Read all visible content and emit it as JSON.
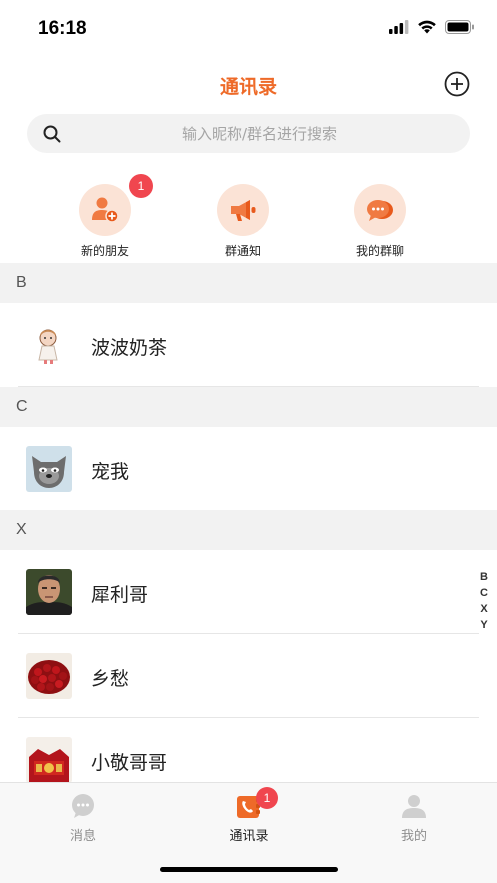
{
  "status_bar": {
    "time": "16:18"
  },
  "nav": {
    "title": "通讯录"
  },
  "search": {
    "placeholder": "输入昵称/群名进行搜索"
  },
  "quick_actions": [
    {
      "label": "新的朋友",
      "badge": "1",
      "icon": "add-user-icon"
    },
    {
      "label": "群通知",
      "icon": "megaphone-icon"
    },
    {
      "label": "我的群聊",
      "icon": "chat-bubbles-icon"
    }
  ],
  "sections": [
    {
      "letter": "B",
      "contacts": [
        {
          "name": "波波奶茶"
        }
      ]
    },
    {
      "letter": "C",
      "contacts": [
        {
          "name": "宠我"
        }
      ]
    },
    {
      "letter": "X",
      "contacts": [
        {
          "name": "犀利哥"
        },
        {
          "name": "乡愁"
        },
        {
          "name": "小敬哥哥"
        }
      ]
    }
  ],
  "index_letters": [
    "B",
    "C",
    "X",
    "Y"
  ],
  "tabs": [
    {
      "label": "消息",
      "icon": "message-icon",
      "active": false
    },
    {
      "label": "通讯录",
      "icon": "contacts-icon",
      "active": true,
      "badge": "1"
    },
    {
      "label": "我的",
      "icon": "profile-icon",
      "active": false
    }
  ],
  "colors": {
    "accent": "#ee6a28",
    "badge": "#f0464f",
    "section_bg": "#f2f2f2",
    "quick_circle": "#fbe3d6"
  }
}
